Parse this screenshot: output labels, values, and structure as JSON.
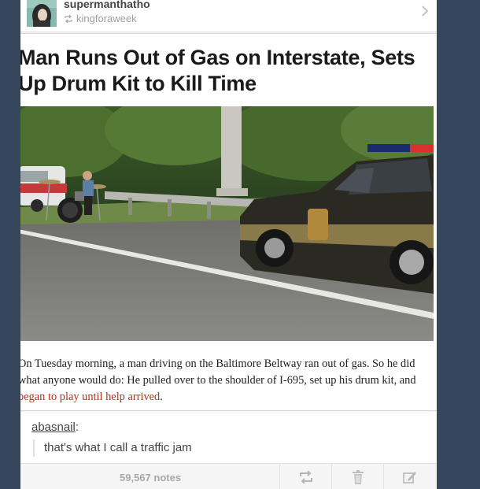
{
  "post": {
    "author": "supermanthatho",
    "reblogged_from": "kingforaweek",
    "headline": "Man Runs Out of Gas on Interstate, Sets Up Drum Kit to Kill Time",
    "caption_main": "On Tuesday morning, a man driving on the Baltimore Beltway ran out of gas. So he did what anyone would do: He pulled over to the shoulder of I-695, set up his drum kit, and ",
    "caption_link": "began to play until help arrived",
    "caption_end": ".",
    "comment_user": "abasnail",
    "comment_sep": ":",
    "comment_text": "that's what I call a traffic jam",
    "notes": "59,567 notes"
  },
  "colors": {
    "background": "#36465d",
    "link_red": "#b03020",
    "muted": "#a7a7a7"
  },
  "icons": [
    "reblog-icon",
    "chevron-right-icon",
    "trash-icon",
    "edit-icon"
  ]
}
